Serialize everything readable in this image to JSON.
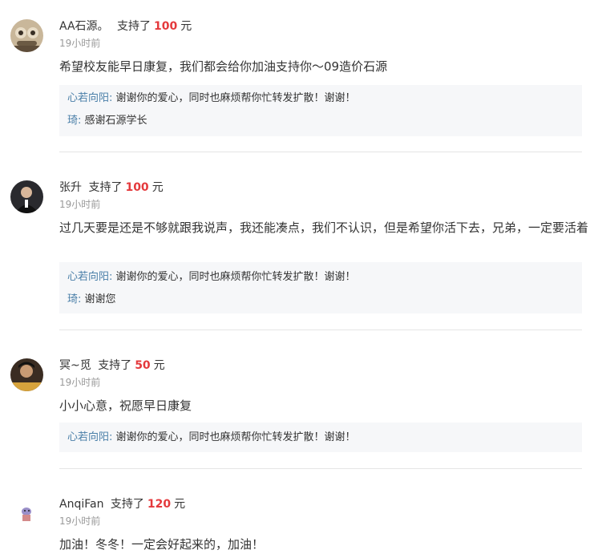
{
  "comments": [
    {
      "name": "AA石源。",
      "supported": "支持了",
      "amount": "100",
      "unit": "元",
      "time": "19小时前",
      "message": "希望校友能早日康复，我们都会给你加油支持你～09造价石源",
      "replies": [
        {
          "who": "心若向阳:",
          "text": "谢谢你的爱心，同时也麻烦帮你忙转发扩散！谢谢！"
        },
        {
          "who": "琦:",
          "text": "感谢石源学长"
        }
      ]
    },
    {
      "name": "张升",
      "supported": "支持了",
      "amount": "100",
      "unit": "元",
      "time": "19小时前",
      "message": "过几天要是还是不够就跟我说声，我还能凑点，我们不认识，但是希望你活下去，兄弟，一定要活着",
      "replies": [
        {
          "who": "心若向阳:",
          "text": "谢谢你的爱心，同时也麻烦帮你忙转发扩散！谢谢！"
        },
        {
          "who": "琦:",
          "text": "谢谢您"
        }
      ]
    },
    {
      "name": "冥~觅",
      "supported": "支持了",
      "amount": "50",
      "unit": "元",
      "time": "19小时前",
      "message": "小小心意，祝愿早日康复",
      "replies": [
        {
          "who": "心若向阳:",
          "text": "谢谢你的爱心，同时也麻烦帮你忙转发扩散！谢谢！"
        }
      ]
    },
    {
      "name": "AnqiFan",
      "supported": "支持了",
      "amount": "120",
      "unit": "元",
      "time": "19小时前",
      "message": "加油！冬冬！一定会好起来的，加油！",
      "replies": []
    }
  ],
  "colors": {
    "amount": "#e4393c",
    "reply_name": "#4a7fa8",
    "time": "#999999",
    "reply_bg": "#f6f7f9",
    "divider": "#e5e5e5"
  }
}
